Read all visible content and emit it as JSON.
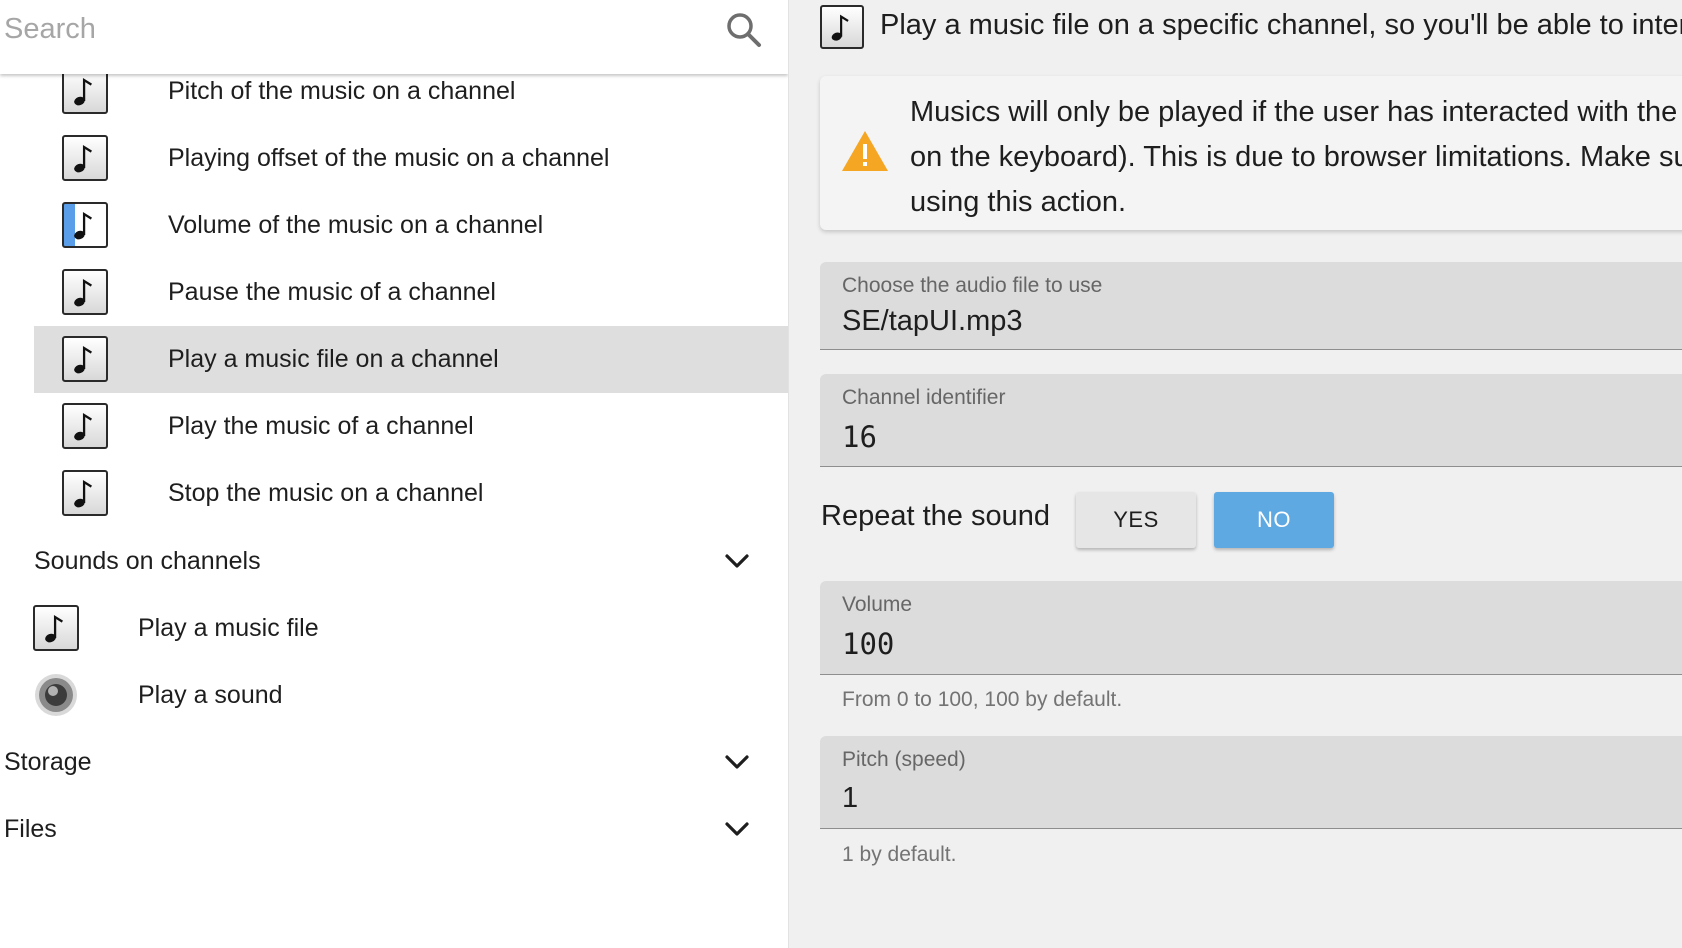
{
  "search": {
    "placeholder": "Search"
  },
  "list": {
    "sub_items": [
      {
        "label": "Pitch of the music on a channel",
        "icon": "music-note-icon"
      },
      {
        "label": "Playing offset of the music on a channel",
        "icon": "music-note-icon"
      },
      {
        "label": "Volume of the music on a channel",
        "icon": "music-volume-icon"
      },
      {
        "label": "Pause the music of a channel",
        "icon": "music-note-icon"
      },
      {
        "label": "Play a music file on a channel",
        "icon": "music-note-icon",
        "selected": true
      },
      {
        "label": "Play the music of a channel",
        "icon": "music-note-icon"
      },
      {
        "label": "Stop the music on a channel",
        "icon": "music-note-icon"
      }
    ],
    "sounds_group": {
      "label": "Sounds on channels",
      "items": [
        {
          "label": "Play a music file",
          "icon": "music-note-icon"
        },
        {
          "label": "Play a sound",
          "icon": "speaker-icon"
        }
      ]
    },
    "categories": [
      {
        "label": "Storage"
      },
      {
        "label": "Files"
      }
    ]
  },
  "details": {
    "description": "Play a music file on a specific channel, so you'll be able to interact with it later.",
    "warning_lines": [
      "Musics will only be played if the user has interacted with the game before (by clicking/touching it or by pressing a key",
      "on the keyboard). This is due to browser limitations. Make sure to have the user interact with the game before",
      "using this action."
    ],
    "audio_file": {
      "label": "Choose the audio file to use",
      "value": "SE/tapUI.mp3"
    },
    "channel": {
      "label": "Channel identifier",
      "value": "16"
    },
    "repeat": {
      "label": "Repeat the sound",
      "yes": "YES",
      "no": "NO",
      "selected": "NO"
    },
    "volume": {
      "label": "Volume",
      "value": "100",
      "helper": "From 0 to 100, 100 by default."
    },
    "pitch": {
      "label": "Pitch (speed)",
      "value": "1",
      "helper": "1 by default."
    }
  },
  "colors": {
    "selected_row": "#dedede",
    "toggle_active": "#5fa9e3",
    "warning": "#f5a623"
  }
}
